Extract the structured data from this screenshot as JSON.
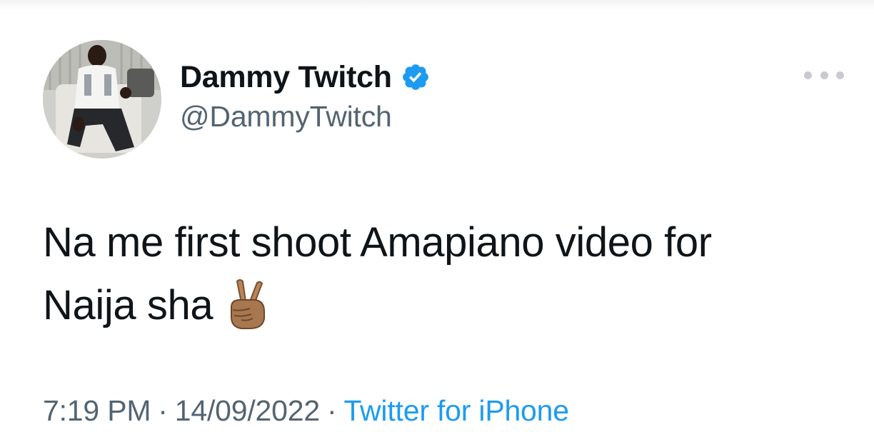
{
  "tweet": {
    "display_name": "Dammy Twitch",
    "handle": "@DammyTwitch",
    "verified_icon": "verified-badge-icon",
    "more_icon": "more-horizontal-icon",
    "text_line1": "Na me first shoot Amapiano video for",
    "text_line2": "Naija sha",
    "emoji": "victory-hand-medium-dark-skin",
    "time": "7:19 PM",
    "separator": "·",
    "date": "14/09/2022",
    "source": "Twitter for iPhone"
  },
  "colors": {
    "text": "#0f1419",
    "secondary": "#536471",
    "link": "#1d9bf0",
    "verified": "#1d9bf0"
  }
}
